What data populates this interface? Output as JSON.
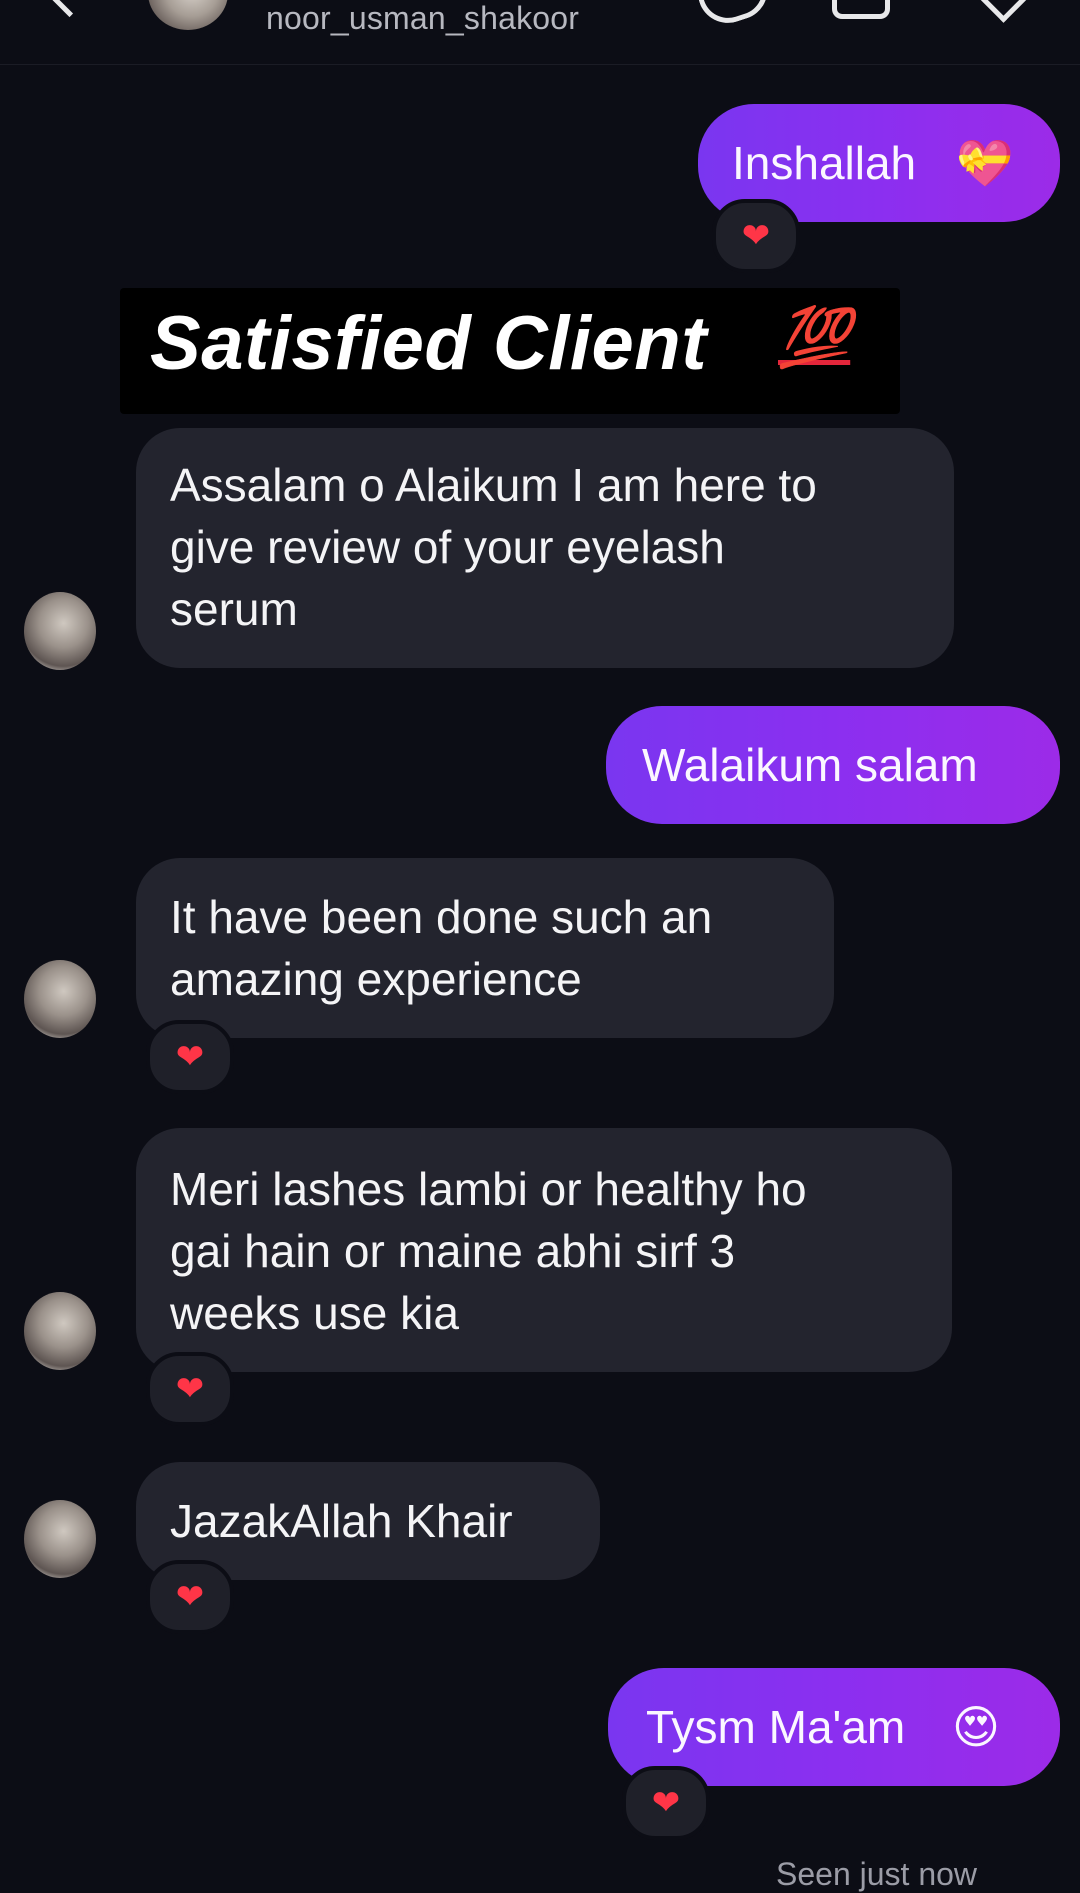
{
  "header": {
    "username": "noor_usman_shakoor"
  },
  "banner": {
    "title": "Satisfied Client",
    "emoji": "💯"
  },
  "messages": [
    {
      "side": "outgoing",
      "text": "Inshallah",
      "emoji": "💝",
      "reaction": "❤"
    },
    {
      "side": "incoming",
      "lines": [
        "Assalam o Alaikum I am here to",
        "give review of your eyelash",
        "serum"
      ]
    },
    {
      "side": "outgoing",
      "text": "Walaikum salam"
    },
    {
      "side": "incoming",
      "lines": [
        "It have been done such an",
        "amazing experience"
      ],
      "reaction": "❤"
    },
    {
      "side": "incoming",
      "lines": [
        "Meri lashes lambi or healthy ho",
        "gai hain or maine abhi sirf 3",
        "weeks use kia"
      ],
      "reaction": "❤"
    },
    {
      "side": "incoming",
      "lines": [
        "JazakAllah Khair"
      ],
      "reaction": "❤"
    },
    {
      "side": "outgoing",
      "text": "Tysm Ma'am",
      "emoji": "😍",
      "reaction": "❤"
    }
  ],
  "status": {
    "seen": "Seen just now"
  },
  "colors": {
    "background": "#0c0d15",
    "outgoing_bubble": "#8b2ff0",
    "incoming_bubble": "#23242e",
    "reaction_heart": "#ff3547"
  },
  "icons": [
    "back-icon",
    "call-icon",
    "video-icon",
    "info-icon"
  ]
}
